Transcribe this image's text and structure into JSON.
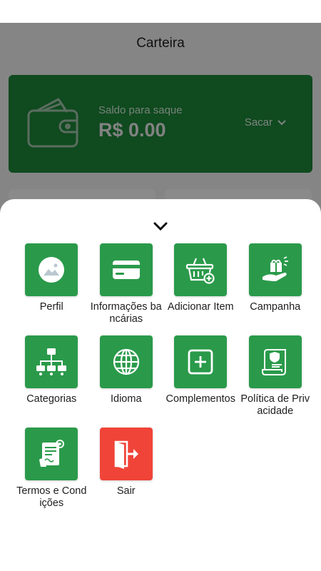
{
  "app": {
    "title": "Carteira"
  },
  "wallet": {
    "label": "Saldo para saque",
    "amount": "R$ 0.00",
    "withdraw_label": "Sacar"
  },
  "sheet": {
    "items": [
      {
        "label": "Perfil",
        "icon": "profile-image-icon",
        "color": "#2a9a4a"
      },
      {
        "label": "Informações bancárias",
        "icon": "credit-card-icon",
        "color": "#2a9a4a"
      },
      {
        "label": "Adicionar Item",
        "icon": "basket-add-icon",
        "color": "#2a9a4a"
      },
      {
        "label": "Campanha",
        "icon": "campaign-gift-icon",
        "color": "#2a9a4a"
      },
      {
        "label": "Categorias",
        "icon": "hierarchy-icon",
        "color": "#2a9a4a"
      },
      {
        "label": "Idioma",
        "icon": "globe-icon",
        "color": "#2a9a4a"
      },
      {
        "label": "Complementos",
        "icon": "plus-square-icon",
        "color": "#2a9a4a"
      },
      {
        "label": "Política de Privacidade",
        "icon": "privacy-scroll-icon",
        "color": "#2a9a4a"
      },
      {
        "label": "Termos e Condições",
        "icon": "terms-document-icon",
        "color": "#2a9a4a"
      },
      {
        "label": "Sair",
        "icon": "logout-door-icon",
        "color": "#f04438"
      }
    ]
  }
}
